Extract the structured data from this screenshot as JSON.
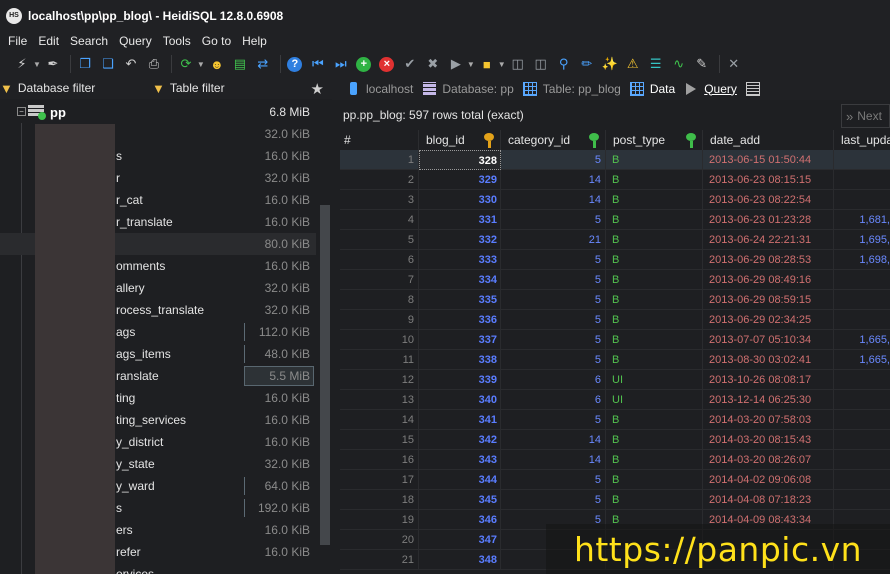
{
  "window": {
    "title": "localhost\\pp\\pp_blog\\ - HeidiSQL 12.8.0.6908",
    "logo_text": "HS"
  },
  "menu": [
    "File",
    "Edit",
    "Search",
    "Query",
    "Tools",
    "Go to",
    "Help"
  ],
  "left_panel": {
    "database_filter_label": "Database filter",
    "table_filter_label": "Table filter",
    "database": {
      "name": "pp",
      "size": "6.8 MiB"
    },
    "tables": [
      {
        "label": "",
        "size": "32.0 KiB"
      },
      {
        "label": "s",
        "size": "16.0 KiB"
      },
      {
        "label": "r",
        "size": "32.0 KiB"
      },
      {
        "label": "r_cat",
        "size": "16.0 KiB"
      },
      {
        "label": "r_translate",
        "size": "16.0 KiB"
      },
      {
        "label": "",
        "size": "80.0 KiB"
      },
      {
        "label": "omments",
        "size": "16.0 KiB"
      },
      {
        "label": "allery",
        "size": "32.0 KiB"
      },
      {
        "label": "rocess_translate",
        "size": "32.0 KiB"
      },
      {
        "label": "ags",
        "size": "112.0 KiB"
      },
      {
        "label": "ags_items",
        "size": "48.0 KiB"
      },
      {
        "label": "ranslate",
        "size": "5.5 MiB"
      },
      {
        "label": "ting",
        "size": "16.0 KiB"
      },
      {
        "label": "ting_services",
        "size": "16.0 KiB"
      },
      {
        "label": "y_district",
        "size": "16.0 KiB"
      },
      {
        "label": "y_state",
        "size": "32.0 KiB"
      },
      {
        "label": "y_ward",
        "size": "64.0 KiB"
      },
      {
        "label": "s",
        "size": "192.0 KiB"
      },
      {
        "label": "ers",
        "size": "16.0 KiB"
      },
      {
        "label": "refer",
        "size": "16.0 KiB"
      },
      {
        "label": "ervices",
        "size": ""
      }
    ]
  },
  "tabs": {
    "host": "localhost",
    "database": "Database: pp",
    "table": "Table: pp_blog",
    "data": "Data",
    "query": "Query"
  },
  "grid": {
    "info": "pp.pp_blog: 597 rows total (exact)",
    "next_label": "Next",
    "columns": {
      "row": "#",
      "blog_id": "blog_id",
      "category_id": "category_id",
      "post_type": "post_type",
      "date_add": "date_add",
      "last_update": "last_upda"
    },
    "rows": [
      {
        "n": "1",
        "blog_id": "328",
        "category_id": "5",
        "post_type": "B",
        "date_add": "2013-06-15 01:50:44",
        "last_update": ""
      },
      {
        "n": "2",
        "blog_id": "329",
        "category_id": "14",
        "post_type": "B",
        "date_add": "2013-06-23 08:15:15",
        "last_update": ""
      },
      {
        "n": "3",
        "blog_id": "330",
        "category_id": "14",
        "post_type": "B",
        "date_add": "2013-06-23 08:22:54",
        "last_update": ""
      },
      {
        "n": "4",
        "blog_id": "331",
        "category_id": "5",
        "post_type": "B",
        "date_add": "2013-06-23 01:23:28",
        "last_update": "1,681,"
      },
      {
        "n": "5",
        "blog_id": "332",
        "category_id": "21",
        "post_type": "B",
        "date_add": "2013-06-24 22:21:31",
        "last_update": "1,695,"
      },
      {
        "n": "6",
        "blog_id": "333",
        "category_id": "5",
        "post_type": "B",
        "date_add": "2013-06-29 08:28:53",
        "last_update": "1,698,"
      },
      {
        "n": "7",
        "blog_id": "334",
        "category_id": "5",
        "post_type": "B",
        "date_add": "2013-06-29 08:49:16",
        "last_update": ""
      },
      {
        "n": "8",
        "blog_id": "335",
        "category_id": "5",
        "post_type": "B",
        "date_add": "2013-06-29 08:59:15",
        "last_update": ""
      },
      {
        "n": "9",
        "blog_id": "336",
        "category_id": "5",
        "post_type": "B",
        "date_add": "2013-06-29 02:34:25",
        "last_update": ""
      },
      {
        "n": "10",
        "blog_id": "337",
        "category_id": "5",
        "post_type": "B",
        "date_add": "2013-07-07 05:10:34",
        "last_update": "1,665,"
      },
      {
        "n": "11",
        "blog_id": "338",
        "category_id": "5",
        "post_type": "B",
        "date_add": "2013-08-30 03:02:41",
        "last_update": "1,665,"
      },
      {
        "n": "12",
        "blog_id": "339",
        "category_id": "6",
        "post_type": "UI",
        "date_add": "2013-10-26 08:08:17",
        "last_update": ""
      },
      {
        "n": "13",
        "blog_id": "340",
        "category_id": "6",
        "post_type": "UI",
        "date_add": "2013-12-14 06:25:30",
        "last_update": ""
      },
      {
        "n": "14",
        "blog_id": "341",
        "category_id": "5",
        "post_type": "B",
        "date_add": "2014-03-20 07:58:03",
        "last_update": ""
      },
      {
        "n": "15",
        "blog_id": "342",
        "category_id": "14",
        "post_type": "B",
        "date_add": "2014-03-20 08:15:43",
        "last_update": ""
      },
      {
        "n": "16",
        "blog_id": "343",
        "category_id": "14",
        "post_type": "B",
        "date_add": "2014-03-20 08:26:07",
        "last_update": ""
      },
      {
        "n": "17",
        "blog_id": "344",
        "category_id": "5",
        "post_type": "B",
        "date_add": "2014-04-02 09:06:08",
        "last_update": ""
      },
      {
        "n": "18",
        "blog_id": "345",
        "category_id": "5",
        "post_type": "B",
        "date_add": "2014-04-08 07:18:23",
        "last_update": ""
      },
      {
        "n": "19",
        "blog_id": "346",
        "category_id": "5",
        "post_type": "B",
        "date_add": "2014-04-09 08:43:34",
        "last_update": ""
      },
      {
        "n": "20",
        "blog_id": "347",
        "category_id": "",
        "post_type": "",
        "date_add": "",
        "last_update": ""
      },
      {
        "n": "21",
        "blog_id": "348",
        "category_id": "",
        "post_type": "",
        "date_add": "",
        "last_update": ""
      }
    ]
  },
  "watermark": "https://panpic.vn",
  "colors": {
    "accent": "#4aa3ff",
    "background": "#1e1f22",
    "number": "#5a7dff",
    "date": "#d07070",
    "enum": "#52c24f"
  }
}
